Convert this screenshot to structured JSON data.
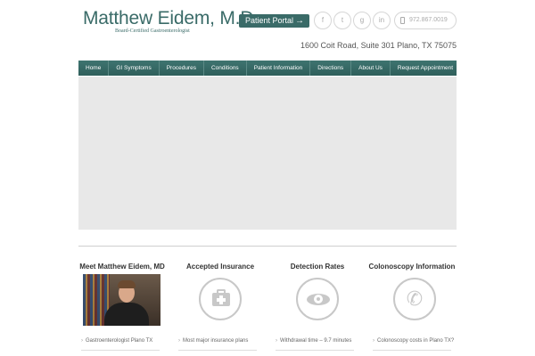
{
  "header": {
    "logo_name": "Matthew Eidem, M.D.",
    "logo_subtitle": "Board-Certified Gastroenterologist",
    "portal_label": "Patient Portal",
    "portal_arrow": "→",
    "social": [
      {
        "label": "f",
        "icon": "facebook-icon"
      },
      {
        "label": "t",
        "icon": "twitter-icon"
      },
      {
        "label": "g",
        "icon": "google-plus-icon"
      },
      {
        "label": "in",
        "icon": "linkedin-icon"
      }
    ],
    "phone": "972.867.0019",
    "address": "1600 Coit Road, Suite 301 Plano, TX 75075"
  },
  "nav": {
    "items": [
      "Home",
      "GI Symptoms",
      "Procedures",
      "Conditions",
      "Patient Information",
      "Directions",
      "About Us",
      "Request Appointment"
    ]
  },
  "features": [
    {
      "title": "Meet Matthew Eidem, MD",
      "icon": "doctor-photo",
      "link": "Gastroenterologist Plano TX"
    },
    {
      "title": "Accepted Insurance",
      "icon": "medkit-icon",
      "link": "Most major insurance plans"
    },
    {
      "title": "Detection Rates",
      "icon": "eye-icon",
      "link": "Withdrawal time – 9.7 minutes"
    },
    {
      "title": "Colonoscopy Information",
      "icon": "phone-icon",
      "link": "Colonoscopy costs in Plano TX?"
    }
  ],
  "colors": {
    "brand": "#3a6b68",
    "nav_bg": "#2f5f5b",
    "slider_bg": "#e8e8e8",
    "icon_gray": "#c8c8c8"
  }
}
